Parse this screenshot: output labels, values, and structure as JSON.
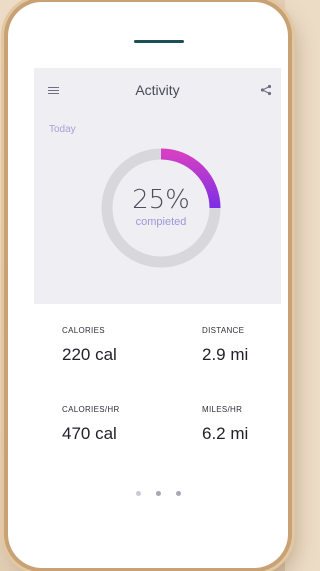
{
  "app": {
    "title": "Activity"
  },
  "header": {
    "menu_icon": "hamburger-menu-icon",
    "share_icon": "share-icon"
  },
  "summary": {
    "period": "Today",
    "progress_percent": 25,
    "progress_text": "25%",
    "progress_label": "compieted"
  },
  "stats": [
    {
      "label": "CALORIES",
      "value": "220 cal"
    },
    {
      "label": "DISTANCE",
      "value": "2.9 mi"
    },
    {
      "label": "CALORIES/HR",
      "value": "470 cal"
    },
    {
      "label": "MILES/HR",
      "value": "6.2 mi"
    }
  ],
  "pager": {
    "count": 3,
    "active_index": 0
  },
  "colors": {
    "ring_start": "#d53fc4",
    "ring_end": "#7a2fe6",
    "ring_track": "#d7d7dc",
    "accent_text": "#a9a0d8",
    "screen_bg": "#eeeef3"
  }
}
